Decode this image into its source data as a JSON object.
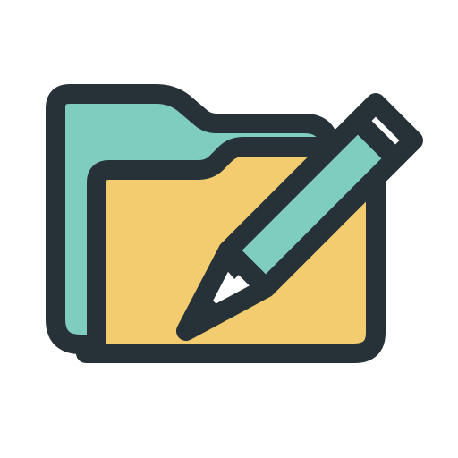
{
  "icon": {
    "name": "folder-edit-icon",
    "colors": {
      "outline": "#263238",
      "folder_back": "#7ecdbf",
      "folder_front": "#f2cc6e",
      "pencil_body": "#7ecdbf",
      "pencil_tip": "#ffffff",
      "background": "#ffffff"
    }
  }
}
